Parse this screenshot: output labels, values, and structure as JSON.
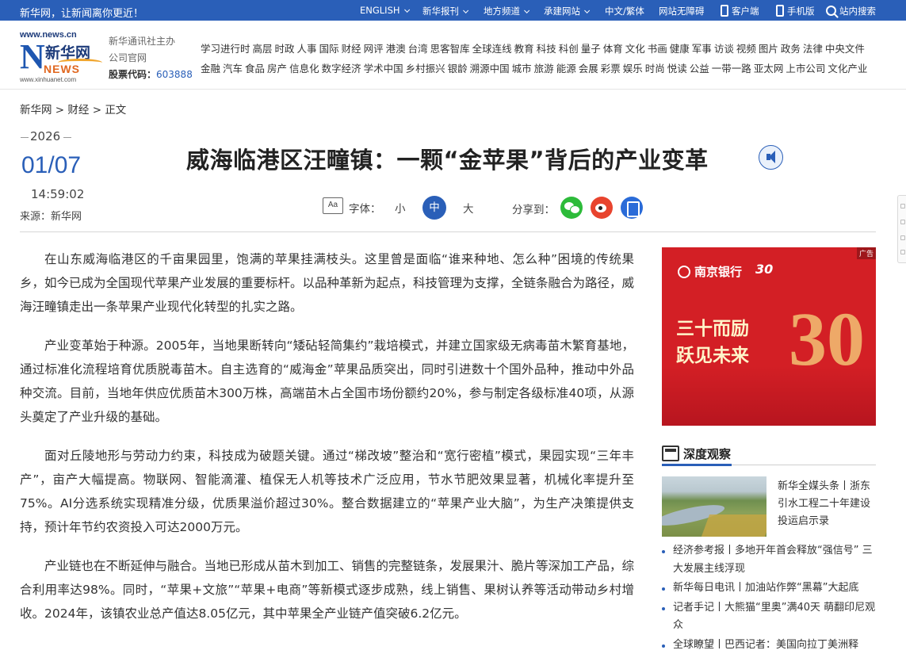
{
  "topbar": {
    "slogan": "新华网，让新闻离你更近！",
    "nav": [
      {
        "label": "ENGLISH",
        "caret": true
      },
      {
        "label": "新华报刊",
        "caret": true
      },
      {
        "label": "地方频道",
        "caret": true
      },
      {
        "label": "承建网站",
        "caret": true
      },
      {
        "label": "中文/繁体",
        "caret": false
      },
      {
        "label": "网站无障碍",
        "caret": false
      }
    ],
    "client": "客户端",
    "mobile": "手机版",
    "search": "站内搜索"
  },
  "logo": {
    "url": "www.news.cn",
    "name": "新华网",
    "news": "NEWS",
    "domain": "www.xinhuanet.com"
  },
  "org": {
    "line1": "新华通讯社主办",
    "line2": "公司官网",
    "stock_label": "股票代码：",
    "stock_code": "603888"
  },
  "channels": {
    "row1": [
      "学习进行时",
      "高层",
      "时政",
      "人事",
      "国际",
      "财经",
      "网评",
      "港澳",
      "台湾",
      "思客智库",
      "全球连线",
      "教育",
      "科技",
      "科创",
      "量子",
      "体育",
      "文化",
      "书画",
      "健康",
      "军事",
      "访谈",
      "视频",
      "图片",
      "政务",
      "法律",
      "中央文件"
    ],
    "row2": [
      "金融",
      "汽车",
      "食品",
      "房产",
      "信息化",
      "数字经济",
      "学术中国",
      "乡村振兴",
      "银龄",
      "溯源中国",
      "城市",
      "旅游",
      "能源",
      "会展",
      "彩票",
      "娱乐",
      "时尚",
      "悦读",
      "公益",
      "一带一路",
      "亚太网",
      "上市公司",
      "文化产业"
    ]
  },
  "breadcrumb": {
    "home": "新华网",
    "sep": ">",
    "section": "财经",
    "current": "正文"
  },
  "article_meta": {
    "year": "2026",
    "date": "01/07",
    "time": "14:59:02",
    "source": "来源：新华网"
  },
  "article": {
    "title": "威海临港区汪疃镇：一颗“金苹果”背后的产业变革",
    "font_label": "字体：",
    "font_small": "小",
    "font_medium": "中",
    "font_large": "大",
    "share_label": "分享到：",
    "paragraphs": [
      "在山东威海临港区的千亩果园里，饱满的苹果挂满枝头。这里曾是面临“谁来种地、怎么种”困境的传统果乡，如今已成为全国现代苹果产业发展的重要标杆。以品种革新为起点，科技管理为支撑，全链条融合为路径，威海汪疃镇走出一条苹果产业现代化转型的扎实之路。",
      "产业变革始于种源。2005年，当地果断转向“矮砧轻简集约”栽培模式，并建立国家级无病毒苗木繁育基地，通过标准化流程培育优质脱毒苗木。自主选育的“威海金”苹果品质突出，同时引进数十个国外品种，推动中外品种交流。目前，当地年供应优质苗木300万株，高端苗木占全国市场份额约20%，参与制定各级标准40项，从源头奠定了产业升级的基础。",
      "面对丘陵地形与劳动力约束，科技成为破题关键。通过“梯改坡”整治和“宽行密植”模式，果园实现“三年丰产”，亩产大幅提高。物联网、智能滴灌、植保无人机等技术广泛应用，节水节肥效果显著，机械化率提升至75%。AI分选系统实现精准分级，优质果溢价超过30%。整合数据建立的“苹果产业大脑”，为生产决策提供支持，预计年节约农资投入可达2000万元。",
      "产业链也在不断延伸与融合。当地已形成从苗木到加工、销售的完整链条，发展果汁、脆片等深加工产品，综合利用率达98%。同时，“苹果+文旅”“苹果+电商”等新模式逐步成熟，线上销售、果树认养等活动带动乡村增收。2024年，该镇农业总产值达8.05亿元，其中苹果全产业链产值突破6.2亿元。"
    ]
  },
  "ad": {
    "tag": "广告",
    "bank": "南京银行",
    "anniv": "30",
    "slogan_line1": "三十而励",
    "slogan_line2": "跃见未来",
    "big": "30"
  },
  "sidebar": {
    "section_title": "深度观察",
    "feature_caption": "新华全媒头条丨浙东引水工程二十年建设投运启示录",
    "news": [
      "经济参考报丨多地开年首会释放“强信号” 三大发展主线浮现",
      "新华每日电讯丨加油站作弊“黑幕”大起底",
      "记者手记丨大熊猫“里奥”满40天 萌翻印尼观众",
      "全球瞭望丨巴西记者：美国向拉丁美洲释"
    ]
  },
  "colors": {
    "brand_blue": "#2a5fb8",
    "ad_red": "#d31f25"
  }
}
